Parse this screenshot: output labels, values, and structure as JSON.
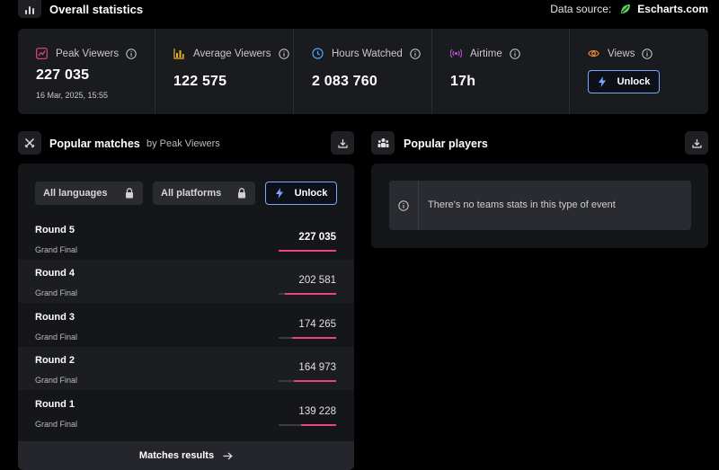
{
  "header": {
    "title": "Overall statistics",
    "data_source_label": "Data source:",
    "data_source_name": "Escharts.com"
  },
  "stats": [
    {
      "label": "Peak Viewers",
      "value": "227 035",
      "sub": "16 Mar, 2025, 15:55",
      "icon": "chart-line-icon",
      "color": "#e8457a"
    },
    {
      "label": "Average Viewers",
      "value": "122 575",
      "icon": "chart-bar-icon",
      "color": "#e6b422"
    },
    {
      "label": "Hours Watched",
      "value": "2 083 760",
      "icon": "clock-icon",
      "color": "#4aa3ff"
    },
    {
      "label": "Airtime",
      "value": "17h",
      "icon": "broadcast-icon",
      "color": "#c05ad6"
    },
    {
      "label": "Views",
      "unlock_label": "Unlock",
      "icon": "eye-icon",
      "color": "#f0883e"
    }
  ],
  "popular_matches": {
    "title": "Popular matches",
    "subtitle": "by Peak Viewers",
    "filters": [
      {
        "label": "All languages",
        "locked": true
      },
      {
        "label": "All platforms",
        "locked": true
      }
    ],
    "unlock_label": "Unlock",
    "matches": [
      {
        "round": "Round 5",
        "type": "Grand Final",
        "value": "227 035",
        "fraction": 1.0
      },
      {
        "round": "Round 4",
        "type": "Grand Final",
        "value": "202 581",
        "fraction": 0.892
      },
      {
        "round": "Round 3",
        "type": "Grand Final",
        "value": "174 265",
        "fraction": 0.768
      },
      {
        "round": "Round 2",
        "type": "Grand Final",
        "value": "164 973",
        "fraction": 0.727
      },
      {
        "round": "Round 1",
        "type": "Grand Final",
        "value": "139 228",
        "fraction": 0.613
      }
    ],
    "results_label": "Matches results"
  },
  "popular_players": {
    "title": "Popular players",
    "notice": "There's no teams stats in this type of event"
  },
  "colors": {
    "accent_pink": "#e8457a",
    "unlock_border": "#7aa7ff",
    "brand_green": "#5ad35a"
  }
}
